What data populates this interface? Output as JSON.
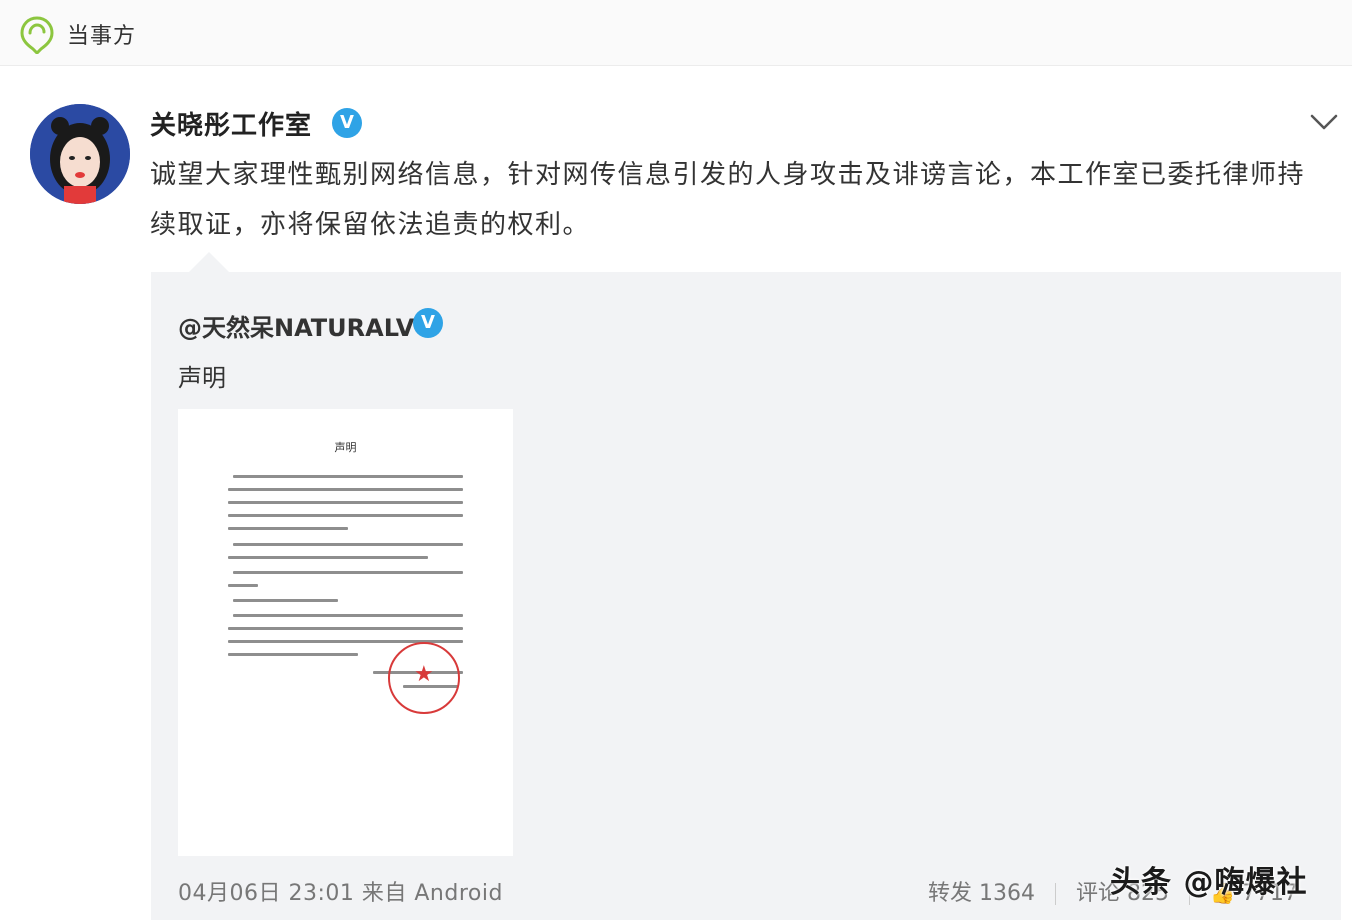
{
  "topbar": {
    "title": "当事方",
    "icon": "location-chat-icon"
  },
  "post": {
    "username": "关晓彤工作室",
    "verified_badge": "V",
    "text": "诚望大家理性甄别网络信息，针对网传信息引发的人身攻击及诽谤言论，本工作室已委托律师持续取证，亦将保留依法追责的权利。"
  },
  "repost": {
    "username": "@天然呆NATURALV",
    "verified_badge": "V",
    "text": "声明",
    "document_title": "声明",
    "meta": "04月06日 23:01 来自 Android",
    "forward_label": "转发 1364",
    "comment_label": "评论 825",
    "like_label": "7717"
  },
  "watermark": "头条 @嗨爆社",
  "colors": {
    "verified": "#2fa3e6",
    "icon_green": "#8cc63f",
    "stamp_red": "#d83a3a"
  }
}
